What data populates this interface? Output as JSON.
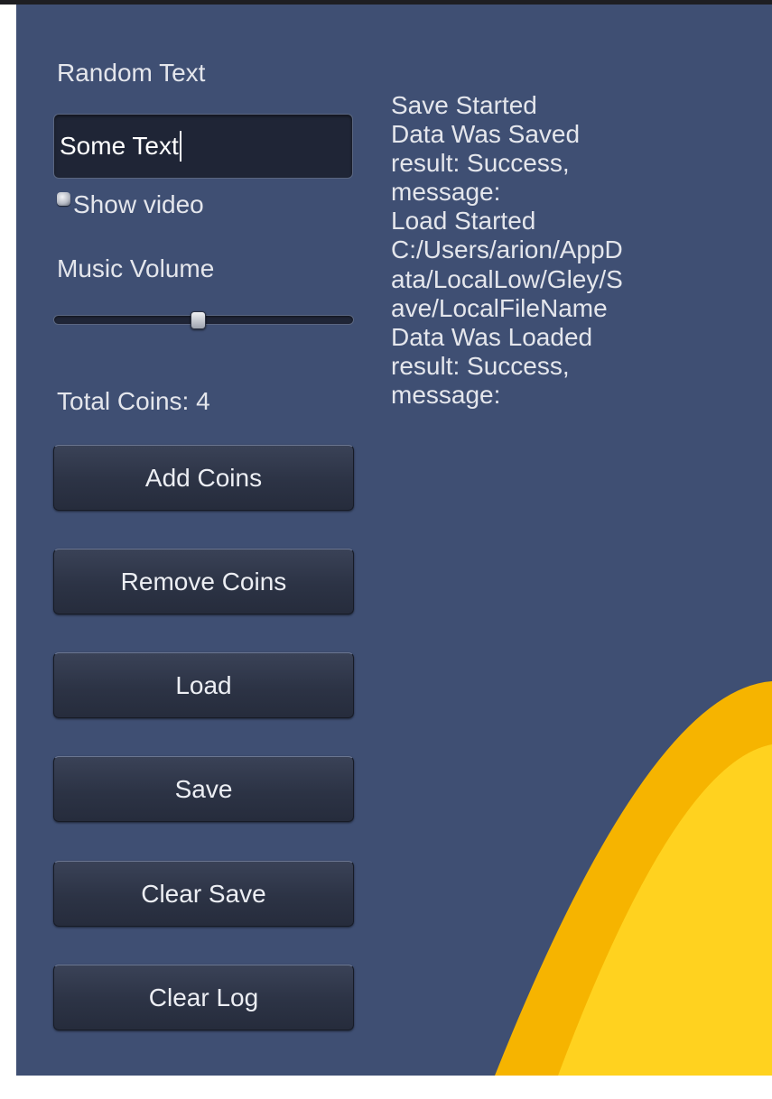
{
  "form": {
    "random_text_label": "Random Text",
    "text_field_value": "Some Text",
    "show_video_label": "Show video",
    "music_volume_label": "Music Volume",
    "music_volume_fraction": 0.48,
    "total_coins_text": "Total Coins: 4"
  },
  "buttons": {
    "add_coins": "Add Coins",
    "remove_coins": "Remove Coins",
    "load": "Load",
    "save": "Save",
    "clear_save": "Clear Save",
    "clear_log": "Clear Log"
  },
  "log": {
    "lines": [
      "Save Started",
      "Data Was Saved",
      "result: Success,",
      "message:",
      "Load Started",
      "C:/Users/arion/AppD",
      "ata/LocalLow/Gley/S",
      "ave/LocalFileName",
      "Data Was Loaded",
      "result: Success,",
      "message:"
    ]
  },
  "colors": {
    "panel_background": "#3f4f73",
    "decoration_outer": "#f6b400",
    "decoration_inner": "#ffd21f"
  }
}
